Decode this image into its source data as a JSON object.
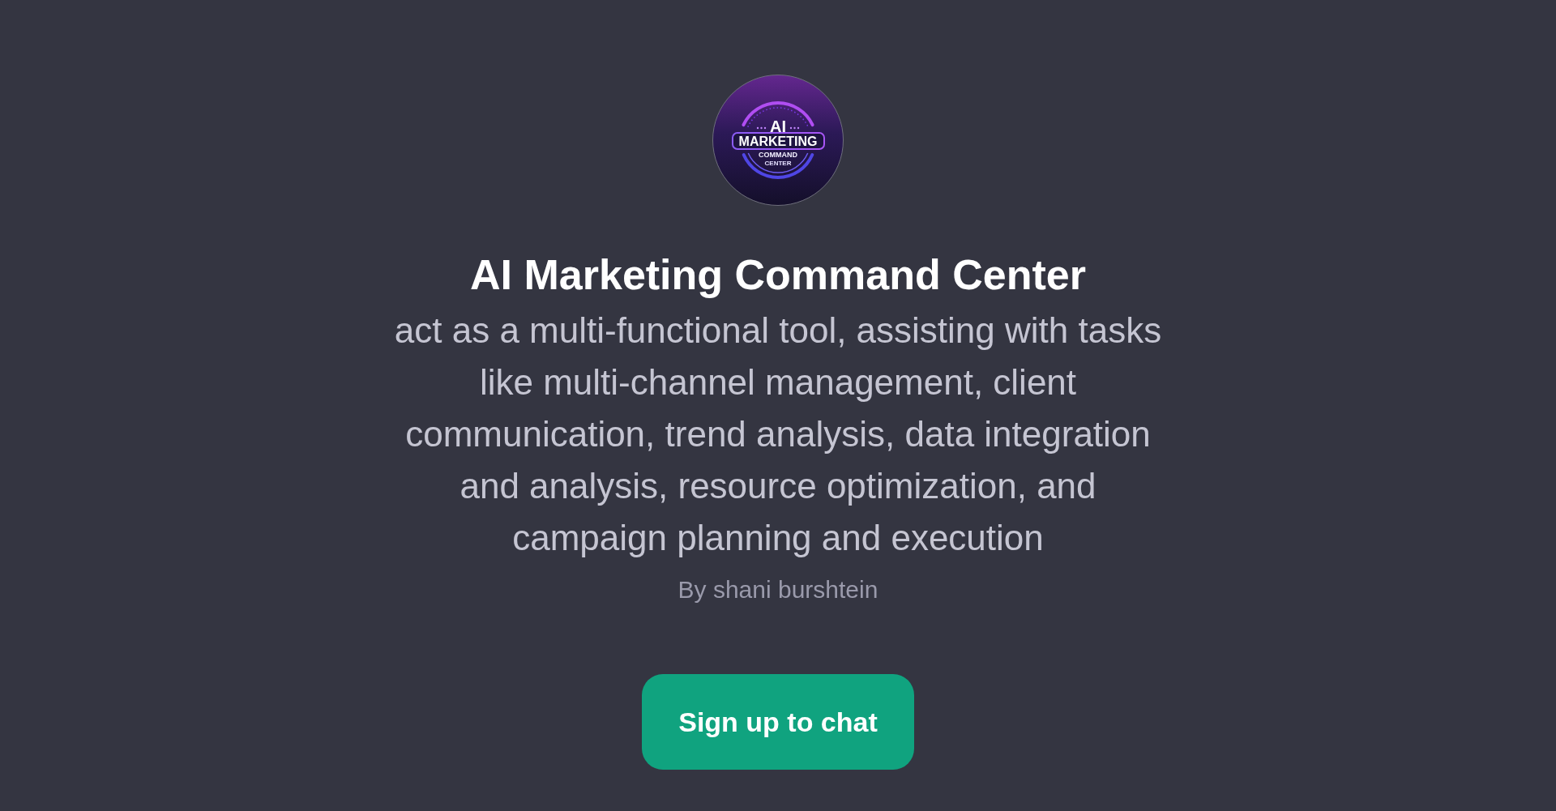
{
  "logo": {
    "lines": [
      "AI",
      "MARKETING",
      "COMMAND",
      "CENTER"
    ]
  },
  "title": "AI Marketing Command Center",
  "description": "act as a multi-functional tool, assisting with tasks like multi-channel management, client communication, trend analysis, data integration and analysis, resource optimization, and campaign planning and execution",
  "author": "By shani burshtein",
  "button": {
    "label": "Sign up to chat"
  }
}
